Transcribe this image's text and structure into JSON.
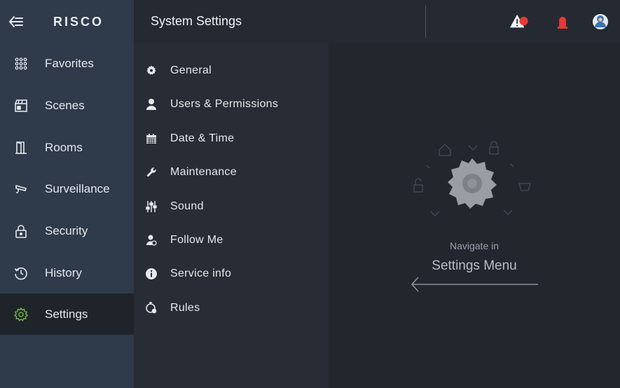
{
  "brand": {
    "logo_text": "RISCO"
  },
  "header": {
    "title": "System Settings"
  },
  "sidebar": {
    "items": [
      {
        "label": "Favorites",
        "icon": "grid-icon",
        "active": false
      },
      {
        "label": "Scenes",
        "icon": "clapperboard-icon",
        "active": false
      },
      {
        "label": "Rooms",
        "icon": "door-icon",
        "active": false
      },
      {
        "label": "Surveillance",
        "icon": "camera-icon",
        "active": false
      },
      {
        "label": "Security",
        "icon": "lock-icon",
        "active": false
      },
      {
        "label": "History",
        "icon": "history-icon",
        "active": false
      },
      {
        "label": "Settings",
        "icon": "gear-icon",
        "active": true
      }
    ]
  },
  "menu": {
    "items": [
      {
        "label": "General",
        "icon": "gear-icon"
      },
      {
        "label": "Users & Permissions",
        "icon": "user-icon"
      },
      {
        "label": "Date & Time",
        "icon": "calendar-icon"
      },
      {
        "label": "Maintenance",
        "icon": "wrench-icon"
      },
      {
        "label": "Sound",
        "icon": "sliders-icon"
      },
      {
        "label": "Follow Me",
        "icon": "follow-me-icon"
      },
      {
        "label": "Service info",
        "icon": "info-icon"
      },
      {
        "label": "Rules",
        "icon": "rules-icon"
      }
    ]
  },
  "hint": {
    "line1": "Navigate in",
    "line2": "Settings Menu"
  },
  "colors": {
    "accent_green": "#6fb33f",
    "alert_red": "#e53935",
    "sidebar_bg": "#2f3a4a",
    "active_bg": "#1f242b"
  }
}
